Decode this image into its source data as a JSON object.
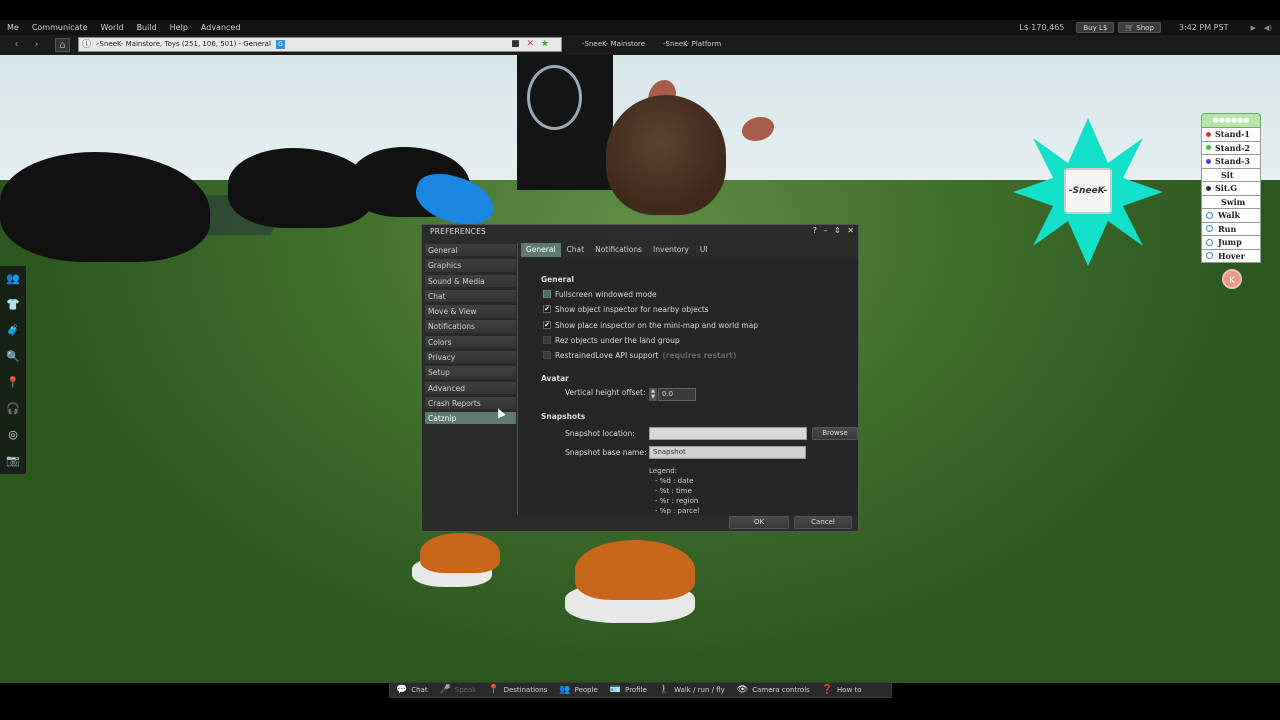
{
  "menubar": {
    "items": [
      "Me",
      "Communicate",
      "World",
      "Build",
      "Help",
      "Advanced"
    ],
    "balance": "L$ 170,465",
    "buy_label": "Buy L$",
    "shop_label": "Shop",
    "time": "3:42 PM PST"
  },
  "navbar": {
    "location": "-SneeK- Mainstore, Toys (251, 106, 501) - General",
    "maturity_badge": "G",
    "favorites": [
      "-SneeK- Mainstore",
      "-SneeK- Platform"
    ]
  },
  "hud": {
    "logo_text": "-SneeK-",
    "anim_items": [
      "Stand-1",
      "Stand-2",
      "Stand-3",
      "Sit",
      "Sit.G",
      "Swim",
      "Walk",
      "Run",
      "Jump",
      "Hover"
    ],
    "anim_colors": [
      "#d33",
      "#3c3",
      "#44c",
      "#fff",
      "#333",
      "#fff"
    ],
    "k_label": "K"
  },
  "prefs": {
    "title": "PREFERENCES",
    "categories": [
      "General",
      "Graphics",
      "Sound & Media",
      "Chat",
      "Move & View",
      "Notifications",
      "Colors",
      "Privacy",
      "Setup",
      "Advanced",
      "Crash Reports",
      "Catznip"
    ],
    "tabs": [
      "General",
      "Chat",
      "Notifications",
      "Inventory",
      "UI"
    ],
    "general_heading": "General",
    "checks": [
      {
        "label": "Fullscreen windowed mode",
        "checked": false
      },
      {
        "label": "Show object inspector for nearby objects",
        "checked": true
      },
      {
        "label": "Show place inspector on the mini-map and world map",
        "checked": true
      },
      {
        "label": "Rez objects under the land group",
        "checked": false
      },
      {
        "label": "RestrainedLove API support",
        "checked": false,
        "hint": "(requires restart)"
      }
    ],
    "avatar_heading": "Avatar",
    "height_label": "Vertical height offset:",
    "height_value": "0.0",
    "snapshots_heading": "Snapshots",
    "location_label": "Snapshot location:",
    "location_value": "",
    "browse_label": "Browse",
    "basename_label": "Snapshot base name:",
    "basename_value": "Snapshot",
    "legend_title": "Legend:",
    "legend_items": [
      "- %d : date",
      "- %t : time",
      "- %r : region",
      "- %p : parcel"
    ],
    "ok_label": "OK",
    "cancel_label": "Cancel"
  },
  "bottombar": {
    "buttons": [
      {
        "label": "Chat",
        "icon": "chat-bubble-icon"
      },
      {
        "label": "Speak",
        "icon": "microphone-icon"
      },
      {
        "label": "Destinations",
        "icon": "map-pin-icon"
      },
      {
        "label": "People",
        "icon": "people-icon"
      },
      {
        "label": "Profile",
        "icon": "profile-card-icon"
      },
      {
        "label": "Walk / run / fly",
        "icon": "walking-person-icon"
      },
      {
        "label": "Camera controls",
        "icon": "eye-icon"
      },
      {
        "label": "How to",
        "icon": "question-icon"
      }
    ]
  }
}
